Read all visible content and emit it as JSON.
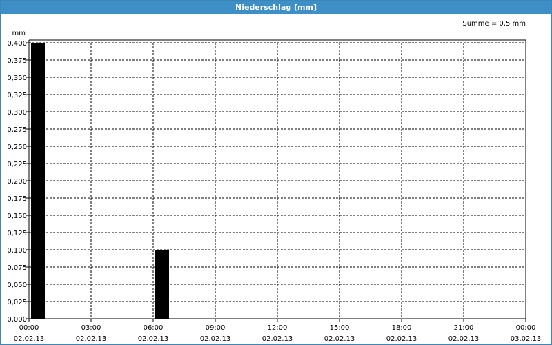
{
  "window": {
    "title": "Niederschlag [mm]"
  },
  "chart_data": {
    "type": "bar",
    "title": "Niederschlag [mm]",
    "ylabel": "mm",
    "summary": "Summe = 0,5 mm",
    "ylim": [
      0,
      0.4
    ],
    "y_ticks": [
      "0,000",
      "0,025",
      "0,050",
      "0,075",
      "0,100",
      "0,125",
      "0,150",
      "0,175",
      "0,200",
      "0,225",
      "0,250",
      "0,275",
      "0,300",
      "0,325",
      "0,350",
      "0,375",
      "0,400"
    ],
    "x_ticks": [
      {
        "time": "00:00",
        "date": "02.02.13"
      },
      {
        "time": "03:00",
        "date": "02.02.13"
      },
      {
        "time": "06:00",
        "date": "02.02.13"
      },
      {
        "time": "09:00",
        "date": "02.02.13"
      },
      {
        "time": "12:00",
        "date": "02.02.13"
      },
      {
        "time": "15:00",
        "date": "02.02.13"
      },
      {
        "time": "18:00",
        "date": "02.02.13"
      },
      {
        "time": "21:00",
        "date": "02.02.13"
      },
      {
        "time": "00:00",
        "date": "03.02.13"
      }
    ],
    "bars": [
      {
        "x": "02.02.13 00:00",
        "value": 0.4
      },
      {
        "x": "02.02.13 06:00",
        "value": 0.1
      }
    ],
    "bar_color": "#000000",
    "grid": true
  }
}
